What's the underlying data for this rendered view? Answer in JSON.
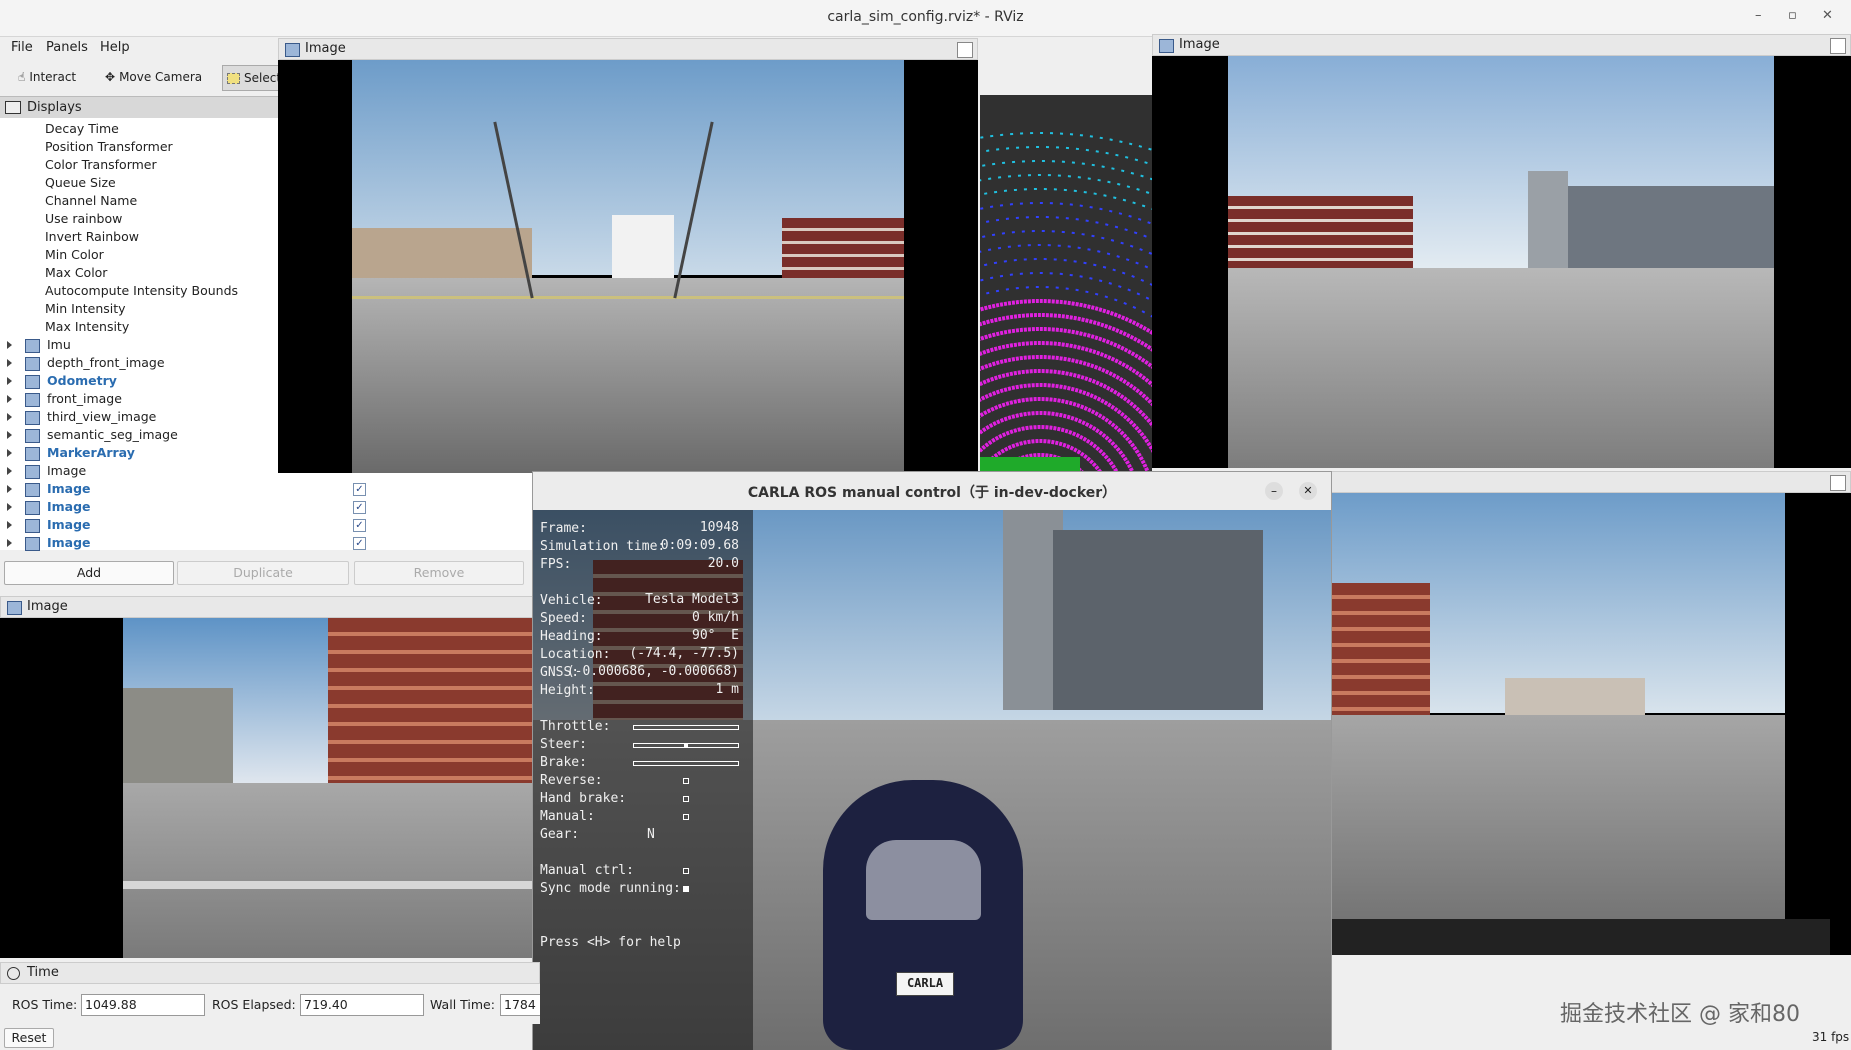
{
  "window": {
    "title": "carla_sim_config.rviz* - RViz",
    "min": "–",
    "max": "▫",
    "close": "✕"
  },
  "menu": [
    "File",
    "Panels",
    "Help"
  ],
  "toolbar": {
    "interact": "Interact",
    "move_camera": "Move Camera",
    "select": "Select"
  },
  "displays": {
    "header": "Displays",
    "properties": [
      "Decay Time",
      "Position Transformer",
      "Color Transformer",
      "Queue Size",
      "Channel Name",
      "Use rainbow",
      "Invert Rainbow",
      "Min Color",
      "Max Color",
      "Autocompute Intensity Bounds",
      "Min Intensity",
      "Max Intensity"
    ],
    "items": [
      {
        "label": "Imu",
        "style": "normal",
        "icon": "imu-icon",
        "checked": false
      },
      {
        "label": "depth_front_image",
        "style": "normal",
        "icon": "image-icon",
        "checked": false
      },
      {
        "label": "Odometry",
        "style": "blue",
        "icon": "odometry-icon",
        "checked": false
      },
      {
        "label": "front_image",
        "style": "normal",
        "icon": "image-icon",
        "checked": false
      },
      {
        "label": "third_view_image",
        "style": "normal",
        "icon": "image-icon",
        "checked": false
      },
      {
        "label": "semantic_seg_image",
        "style": "normal",
        "icon": "image-icon",
        "checked": false
      },
      {
        "label": "MarkerArray",
        "style": "blue",
        "icon": "marker-array-icon",
        "checked": false
      },
      {
        "label": "Image",
        "style": "normal",
        "icon": "image-icon",
        "checked": false
      },
      {
        "label": "Image",
        "style": "blue",
        "icon": "image-icon",
        "checked": true
      },
      {
        "label": "Image",
        "style": "blue",
        "icon": "image-icon",
        "checked": true
      },
      {
        "label": "Image",
        "style": "blue",
        "icon": "image-icon",
        "checked": true
      },
      {
        "label": "Image",
        "style": "blue",
        "icon": "image-icon",
        "checked": true
      }
    ],
    "check_mark": "✓",
    "add": "Add",
    "duplicate": "Duplicate",
    "remove": "Remove"
  },
  "panels": {
    "image_top": "Image",
    "image_right": "Image",
    "image_bottom_left": "Image"
  },
  "carla": {
    "title": "CARLA ROS manual control（于 in-dev-docker）",
    "min": "–",
    "close": "✕",
    "rows": [
      {
        "label": "Frame:",
        "value": "10948"
      },
      {
        "label": "Simulation time:",
        "value": "0:09:09.68"
      },
      {
        "label": "FPS:",
        "value": "20.0"
      },
      {
        "label": "Vehicle:",
        "value": "Tesla Model3"
      },
      {
        "label": "Speed:",
        "value": "0 km/h"
      },
      {
        "label": "Heading:",
        "value": "90°  E"
      },
      {
        "label": "Location:",
        "value": "(-74.4, -77.5)"
      },
      {
        "label": "GNSS:",
        "value": "(-0.000686, -0.000668)"
      },
      {
        "label": "Height:",
        "value": "1 m"
      }
    ],
    "controls": [
      "Throttle:",
      "Steer:",
      "Brake:",
      "Reverse:",
      "Hand brake:",
      "Manual:",
      "Gear:"
    ],
    "gear": "N",
    "manual_ctrl": "Manual ctrl:",
    "sync_mode": "Sync mode running:",
    "help": "Press <H> for help",
    "plate": "CARLA"
  },
  "time": {
    "header": "Time",
    "ros_time_label": "ROS Time:",
    "ros_time": "1049.88",
    "ros_elapsed_label": "ROS Elapsed:",
    "ros_elapsed": "719.40",
    "wall_time_label": "Wall Time:",
    "wall_time": "1784",
    "reset": "Reset"
  },
  "watermark": "掘金技术社区 @ 家和80",
  "fps": "31 fps",
  "colors": {
    "lidar_near": "#e020e0",
    "lidar_far": "#3040ff",
    "lidar_cyan": "#20c0e0",
    "blue_text": "#2a6cb0"
  }
}
